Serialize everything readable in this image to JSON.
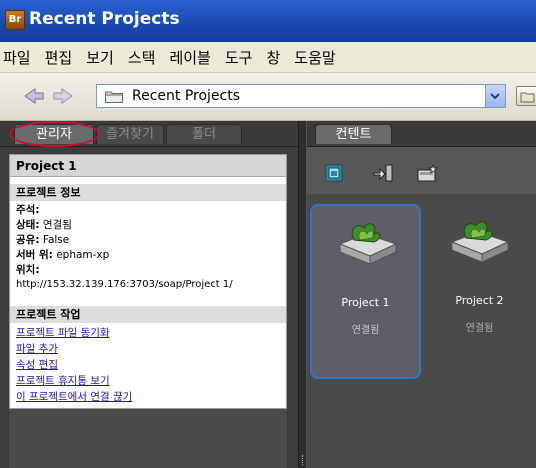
{
  "window": {
    "app_badge": "Br",
    "title": "Recent Projects"
  },
  "menu": [
    "파일",
    "편집",
    "보기",
    "스택",
    "레이블",
    "도구",
    "창",
    "도움말"
  ],
  "toolbar": {
    "path": "Recent Projects"
  },
  "left_tabs": {
    "manager": "관리자",
    "favorites": "즐겨찾기",
    "folders": "폴더"
  },
  "project_info": {
    "name": "Project 1",
    "info_header": "프로젝트 정보",
    "comment_label": "주석:",
    "comment_value": "",
    "status_label": "상태:",
    "status_value": "연결됨",
    "shared_label": "공유:",
    "shared_value": "False",
    "server_label": "서버 위:",
    "server_value": "epham-xp",
    "location_label": "위치:",
    "location_value": "http://153.32.139.176:3703/soap/Project 1/",
    "tasks_header": "프로젝트 작업",
    "tasks": [
      "프로젝트 파일 동기화",
      "파일 추가",
      "속성 편집",
      "프로젝트 휴지통 보기",
      "이 프로젝트에서 연결 끊기"
    ]
  },
  "right_tabs": {
    "content": "컨텐트"
  },
  "projects": [
    {
      "name": "Project 1",
      "status": "연결됨"
    },
    {
      "name": "Project 2",
      "status": "연결됨"
    }
  ],
  "colors": {
    "accent": "#3a6fc4",
    "annotation": "#c8102e",
    "title_bar": "#1a48b0"
  }
}
